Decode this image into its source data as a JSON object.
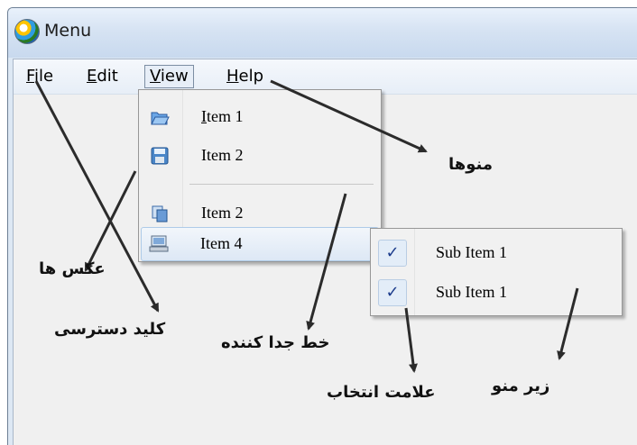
{
  "window": {
    "title": "Menu",
    "icon": "app-globe-icon"
  },
  "menubar": {
    "items": [
      {
        "label": "File",
        "underline": "F",
        "rest": "ile"
      },
      {
        "label": "Edit",
        "underline": "E",
        "rest": "dit"
      },
      {
        "label": "View",
        "underline": "V",
        "rest": "iew"
      },
      {
        "label": "Help",
        "underline": "H",
        "rest": "elp"
      }
    ]
  },
  "dropdown": {
    "items": [
      {
        "label": "Item 1",
        "icon": "open-folder-icon",
        "underline": "I",
        "rest": "tem 1"
      },
      {
        "label": "Item 2",
        "icon": "save-disk-icon"
      },
      {
        "label": "Item 2",
        "icon": "copy-icon"
      },
      {
        "label": "Item 4",
        "icon": "computer-icon",
        "has_submenu": true
      }
    ]
  },
  "submenu": {
    "items": [
      {
        "label": "Sub Item 1",
        "checked": true
      },
      {
        "label": "Sub Item 1",
        "checked": true
      }
    ]
  },
  "annotations": {
    "menus": "منوها",
    "images": "عکس ها",
    "access_key": "کلید دسترسی",
    "separator": "خط جدا کننده",
    "check_mark": "علامت انتخاب",
    "submenu": "زیر منو"
  },
  "colors": {
    "accent": "#1c3c8c",
    "highlight": "#dde8f5"
  }
}
